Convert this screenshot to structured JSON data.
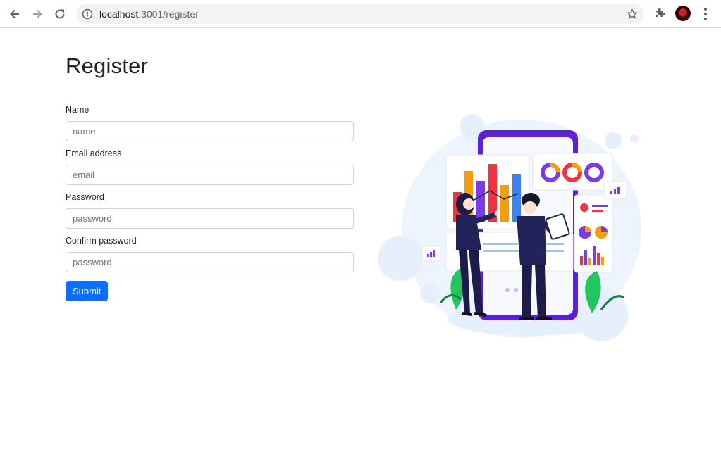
{
  "browser": {
    "url_host": "localhost",
    "url_path": ":3001/register",
    "icons": [
      "back-arrow-icon",
      "forward-arrow-icon",
      "reload-icon",
      "info-icon",
      "star-icon",
      "puzzle-icon",
      "kebab-menu-icon"
    ]
  },
  "page": {
    "title": "Register"
  },
  "form": {
    "name_label": "Name",
    "name_placeholder": "name",
    "email_label": "Email address",
    "email_placeholder": "email",
    "password_label": "Password",
    "password_placeholder": "password",
    "confirm_label": "Confirm password",
    "confirm_placeholder": "password",
    "submit_label": "Submit"
  },
  "colors": {
    "primary": "#0d6efd",
    "illustration_purple": "#5b21d6",
    "illustration_navy": "#23235c"
  }
}
